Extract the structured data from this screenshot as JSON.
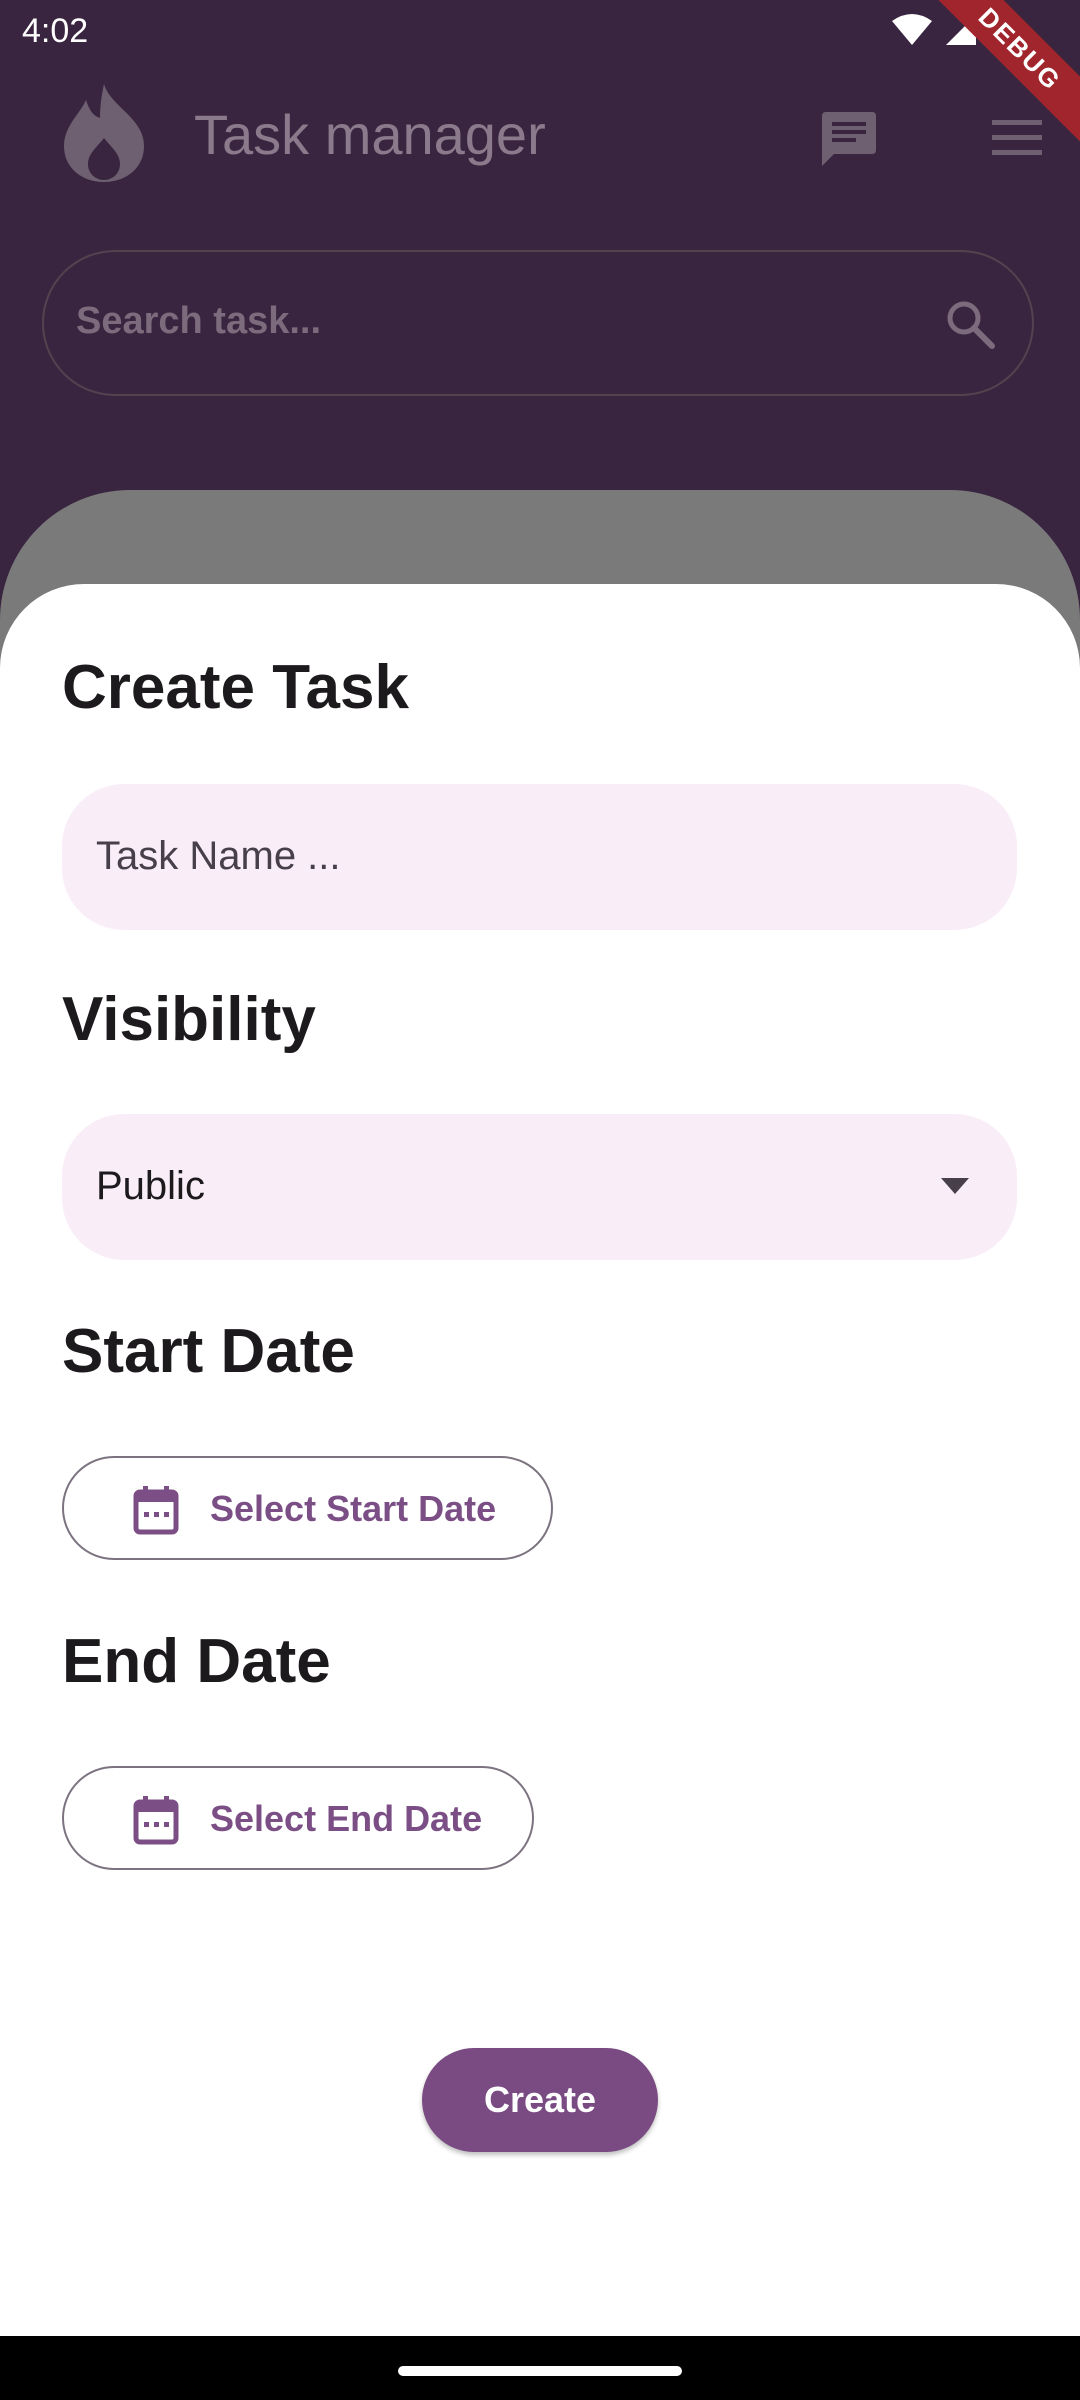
{
  "status_bar": {
    "time": "4:02",
    "debug_label": "DEBUG"
  },
  "app_bar": {
    "title": "Task manager",
    "logo_icon": "flame-logo-icon",
    "chat_icon": "chat-icon",
    "menu_icon": "menu-icon"
  },
  "search": {
    "placeholder": "Search task...",
    "icon": "search-icon"
  },
  "create_task_sheet": {
    "title": "Create Task",
    "task_name_placeholder": "Task Name ...",
    "visibility_label": "Visibility",
    "visibility_value": "Public",
    "start_date_label": "Start Date",
    "start_date_button": "Select Start Date",
    "end_date_label": "End Date",
    "end_date_button": "Select End Date",
    "create_button": "Create"
  },
  "colors": {
    "app_background": "#3a2540",
    "accent": "#7a4a82",
    "field_background": "#f9eef7",
    "debug_ribbon": "#a0252c"
  }
}
